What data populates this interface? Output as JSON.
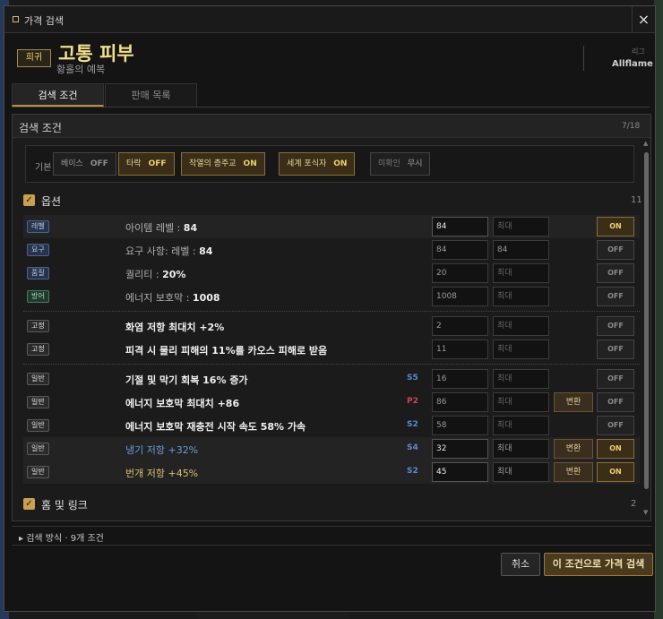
{
  "window": {
    "title": "가격 검색",
    "close": "×"
  },
  "item": {
    "rarity": "희귀",
    "name": "고통 피부",
    "base": "황홀의 예복",
    "league_label": "리그",
    "league": "Allflame"
  },
  "tabs": [
    {
      "label": "검색 조건",
      "active": true
    },
    {
      "label": "판매 목록",
      "active": false
    }
  ],
  "panel": {
    "title": "검색 조건",
    "count": "7/18"
  },
  "base_filters": {
    "label": "기본",
    "chips": [
      {
        "name": "베이스",
        "state": "OFF"
      },
      {
        "name": "타락",
        "state": "OFF"
      },
      {
        "name": "작열의 층주교",
        "state": "ON"
      },
      {
        "name": "세계 포식자",
        "state": "ON"
      },
      {
        "name": "미확인",
        "state": "무시"
      }
    ]
  },
  "options_section": {
    "label": "옵션",
    "count": "11"
  },
  "rows": [
    {
      "tag": "레벨",
      "label_pre": "아이템 레벨 : ",
      "label_val": "84",
      "tier": "",
      "min": "84",
      "max": "최대",
      "convert": "",
      "toggle": "ON"
    },
    {
      "tag": "요구",
      "label_pre": "요구 사항: 레벨 : ",
      "label_val": "84",
      "tier": "",
      "min": "84",
      "max": "84",
      "convert": "",
      "toggle": "OFF"
    },
    {
      "tag": "품질",
      "label_pre": "퀄리티 : ",
      "label_val": "20%",
      "tier": "",
      "min": "20",
      "max": "최대",
      "convert": "",
      "toggle": "OFF"
    },
    {
      "tag": "방어",
      "label_pre": "에너지 보호막 : ",
      "label_val": "1008",
      "tier": "",
      "min": "1008",
      "max": "최대",
      "convert": "",
      "toggle": "OFF"
    },
    {
      "tag": "고정",
      "label": "화염 저항 최대치 +2%",
      "tier": "",
      "min": "2",
      "max": "최대",
      "convert": "",
      "toggle": "OFF"
    },
    {
      "tag": "고정",
      "label": "피격 시 물리 피해의 11%를 카오스 피해로 받음",
      "tier": "",
      "min": "11",
      "max": "최대",
      "convert": "",
      "toggle": "OFF"
    },
    {
      "tag": "일반",
      "label": "기절 및 막기 회복 16% 증가",
      "tier": "S5",
      "min": "16",
      "max": "최대",
      "convert": "",
      "toggle": "OFF"
    },
    {
      "tag": "일반",
      "label": "에너지 보호막 최대치 +86",
      "tier": "P2",
      "min": "86",
      "max": "최대",
      "convert": "변환",
      "toggle": "OFF"
    },
    {
      "tag": "일반",
      "label": "에너지 보호막 재충전 시작 속도 58% 가속",
      "tier": "S2",
      "min": "58",
      "max": "최대",
      "convert": "",
      "toggle": "OFF"
    },
    {
      "tag": "일반",
      "label": "냉기 저항 +32%",
      "tier": "S4",
      "min": "32",
      "max": "최대",
      "convert": "변환",
      "toggle": "ON"
    },
    {
      "tag": "일반",
      "label": "번개 저항 +45%",
      "tier": "S2",
      "min": "45",
      "max": "최대",
      "convert": "변환",
      "toggle": "ON"
    }
  ],
  "sockets_section": {
    "label": "홈 및 링크",
    "count": "2"
  },
  "footer": {
    "search_method": "▸ 검색 방식 · 9개 조건",
    "cancel": "취소",
    "search": "이 조건으로 가격 검색"
  },
  "colors": {
    "accent": "#c8a050",
    "on": "#f0d070",
    "tier_s": "#5a8ad0",
    "tier_p": "#d04848",
    "cold": "#6a9ad8",
    "lightning": "#d8c070"
  }
}
